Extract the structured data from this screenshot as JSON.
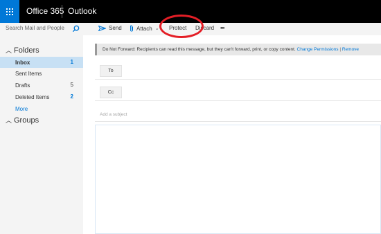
{
  "app": {
    "brand": "Office 365",
    "name": "Outlook"
  },
  "search": {
    "placeholder": "Search Mail and People"
  },
  "sidebar": {
    "folders_header": "Folders",
    "items": [
      {
        "label": "Inbox",
        "count": "1",
        "selected": true
      },
      {
        "label": "Sent Items",
        "count": ""
      },
      {
        "label": "Drafts",
        "count": "5"
      },
      {
        "label": "Deleted Items",
        "count": "2"
      }
    ],
    "more": "More",
    "groups_header": "Groups"
  },
  "toolbar": {
    "send": "Send",
    "attach": "Attach",
    "protect": "Protect",
    "discard": "Discard",
    "more": "•••"
  },
  "notice": {
    "text": "Do Not Forward: Recipients can read this message, but they can't forward, print, or copy content.",
    "change": "Change Permissions",
    "sep": "|",
    "remove": "Remove"
  },
  "compose": {
    "to": "To",
    "cc": "Cc",
    "subject_placeholder": "Add a subject"
  },
  "colors": {
    "accent": "#0078d7",
    "highlight_circle": "#e41e26",
    "topbar": "#000000"
  }
}
